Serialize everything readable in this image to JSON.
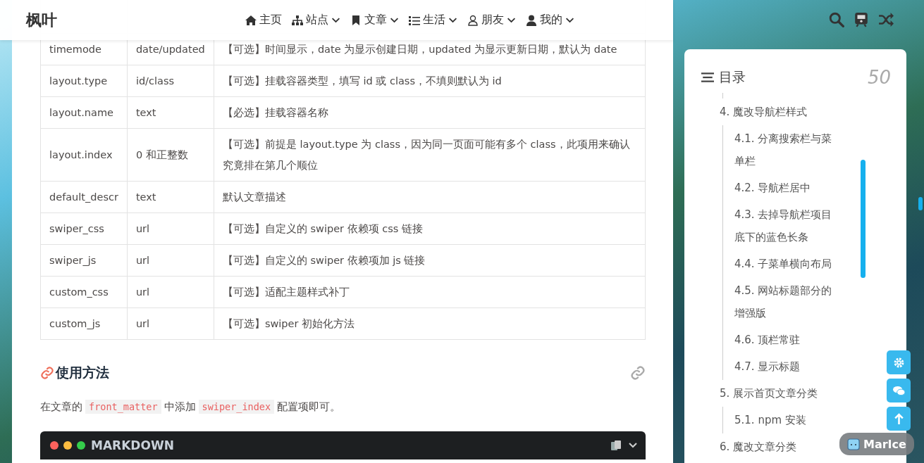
{
  "nav": {
    "logo": "枫叶",
    "menu": [
      {
        "kind": "home",
        "label": "主页",
        "dropdown": false
      },
      {
        "kind": "sitemap",
        "label": "站点",
        "dropdown": true
      },
      {
        "kind": "bookmark",
        "label": "文章",
        "dropdown": true
      },
      {
        "kind": "list",
        "label": "生活",
        "dropdown": true
      },
      {
        "kind": "friend",
        "label": "朋友",
        "dropdown": true
      },
      {
        "kind": "profile",
        "label": "我的",
        "dropdown": true
      }
    ]
  },
  "table": {
    "rows": [
      {
        "name": "timemode",
        "type": "date/updated",
        "desc": "【可选】时间显示，date 为显示创建日期，updated 为显示更新日期，默认为 date"
      },
      {
        "name": "layout.type",
        "type": "id/class",
        "desc": "【可选】挂载容器类型，填写 id 或 class，不填则默认为 id"
      },
      {
        "name": "layout.name",
        "type": "text",
        "desc": "【必选】挂载容器名称"
      },
      {
        "name": "layout.index",
        "type": "0 和正整数",
        "desc": "【可选】前提是 layout.type 为 class，因为同一页面可能有多个 class，此项用来确认究竟排在第几个顺位"
      },
      {
        "name": "default_descr",
        "type": "text",
        "desc": "默认文章描述"
      },
      {
        "name": "swiper_css",
        "type": "url",
        "desc": "【可选】自定义的 swiper 依赖项 css 链接"
      },
      {
        "name": "swiper_js",
        "type": "url",
        "desc": "【可选】自定义的 swiper 依赖项加 js 链接"
      },
      {
        "name": "custom_css",
        "type": "url",
        "desc": "【可选】适配主题样式补丁"
      },
      {
        "name": "custom_js",
        "type": "url",
        "desc": "【可选】swiper 初始化方法"
      }
    ]
  },
  "section": {
    "heading": "使用方法",
    "paragraph": [
      {
        "kind": "text",
        "text": "在文章的"
      },
      {
        "kind": "code",
        "text": "front_matter"
      },
      {
        "kind": "text",
        "text": "中添加"
      },
      {
        "kind": "code",
        "text": "swiper_index"
      },
      {
        "kind": "text",
        "text": "配置项即可。"
      }
    ],
    "code_block": {
      "language": "MARKDOWN"
    }
  },
  "toc": {
    "title": "目录",
    "percent": "50",
    "items": [
      {
        "label": "4. 魔改导航栏样式",
        "children": [
          {
            "label": "4.1. 分离搜索栏与菜单栏"
          },
          {
            "label": "4.2. 导航栏居中"
          },
          {
            "label": "4.3. 去掉导航栏项目底下的蓝色长条"
          },
          {
            "label": "4.4. 子菜单横向布局"
          },
          {
            "label": "4.5. 网站标题部分的增强版"
          },
          {
            "label": "4.6. 顶栏常驻"
          },
          {
            "label": "4.7. 显示标题"
          }
        ]
      },
      {
        "label": "5. 展示首页文章分类",
        "children": [
          {
            "label": "5.1. npm 安装"
          }
        ]
      },
      {
        "label": "6. 魔改文章分类"
      }
    ]
  },
  "badge": {
    "label": "MarIce"
  }
}
